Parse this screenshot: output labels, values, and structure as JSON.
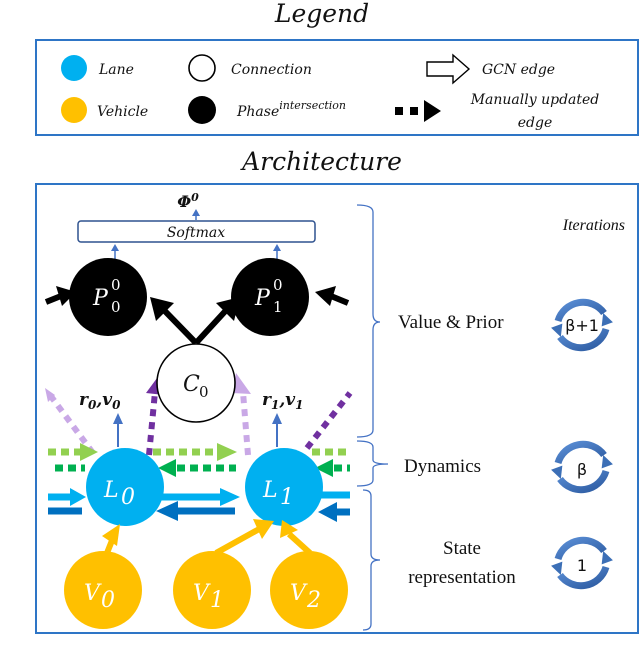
{
  "legend": {
    "title": "Legend",
    "items": [
      {
        "key": "lane",
        "label": "Lane",
        "color": "#00B0F0"
      },
      {
        "key": "vehicle",
        "label": "Vehicle",
        "color": "#FFC000"
      },
      {
        "key": "connection",
        "label": "Connection",
        "color": "#FFFFFF"
      },
      {
        "key": "phase",
        "label": "Phase",
        "superscript": "intersection",
        "color": "#000000"
      },
      {
        "key": "gcn_edge",
        "label": "GCN edge"
      },
      {
        "key": "manual_edge",
        "label_line1": "Manually updated",
        "label_line2": "edge"
      }
    ]
  },
  "architecture": {
    "title": "Architecture",
    "output": {
      "symbol": "Φ",
      "superscript": "0"
    },
    "softmax_label": "Softmax",
    "nodes": {
      "phases": [
        {
          "id": "P0",
          "base": "P",
          "sub": "0",
          "sup": "0"
        },
        {
          "id": "P1",
          "base": "P",
          "sub": "1",
          "sup": "0"
        }
      ],
      "connection": {
        "id": "C0",
        "base": "C",
        "sub": "0"
      },
      "lanes": [
        {
          "id": "L0",
          "base": "L",
          "sub": "0"
        },
        {
          "id": "L1",
          "base": "L",
          "sub": "1"
        }
      ],
      "vehicles": [
        {
          "id": "V0",
          "base": "V",
          "sub": "0"
        },
        {
          "id": "V1",
          "base": "V",
          "sub": "1"
        },
        {
          "id": "V2",
          "base": "V",
          "sub": "2"
        }
      ]
    },
    "lane_outputs": [
      {
        "r": "r",
        "v": "v",
        "sub": "0"
      },
      {
        "r": "r",
        "v": "v",
        "sub": "1"
      }
    ],
    "iterations_title": "Iterations",
    "stages": [
      {
        "label": "Value & Prior",
        "iterations": "β+1"
      },
      {
        "label": "Dynamics",
        "iterations": "β"
      },
      {
        "label_line1": "State",
        "label_line2": "representation",
        "iterations": "1"
      }
    ]
  },
  "colors": {
    "lane": "#00B0F0",
    "vehicle": "#FFC000",
    "phase": "#000000",
    "frame_blue": "#2E75C6",
    "cycle_blue": "#3C6FB6",
    "dark_blue_edge": "#0070C0",
    "light_green": "#92D050",
    "green": "#00B050",
    "purple": "#7030A0",
    "light_purple": "#C9A8E6"
  }
}
